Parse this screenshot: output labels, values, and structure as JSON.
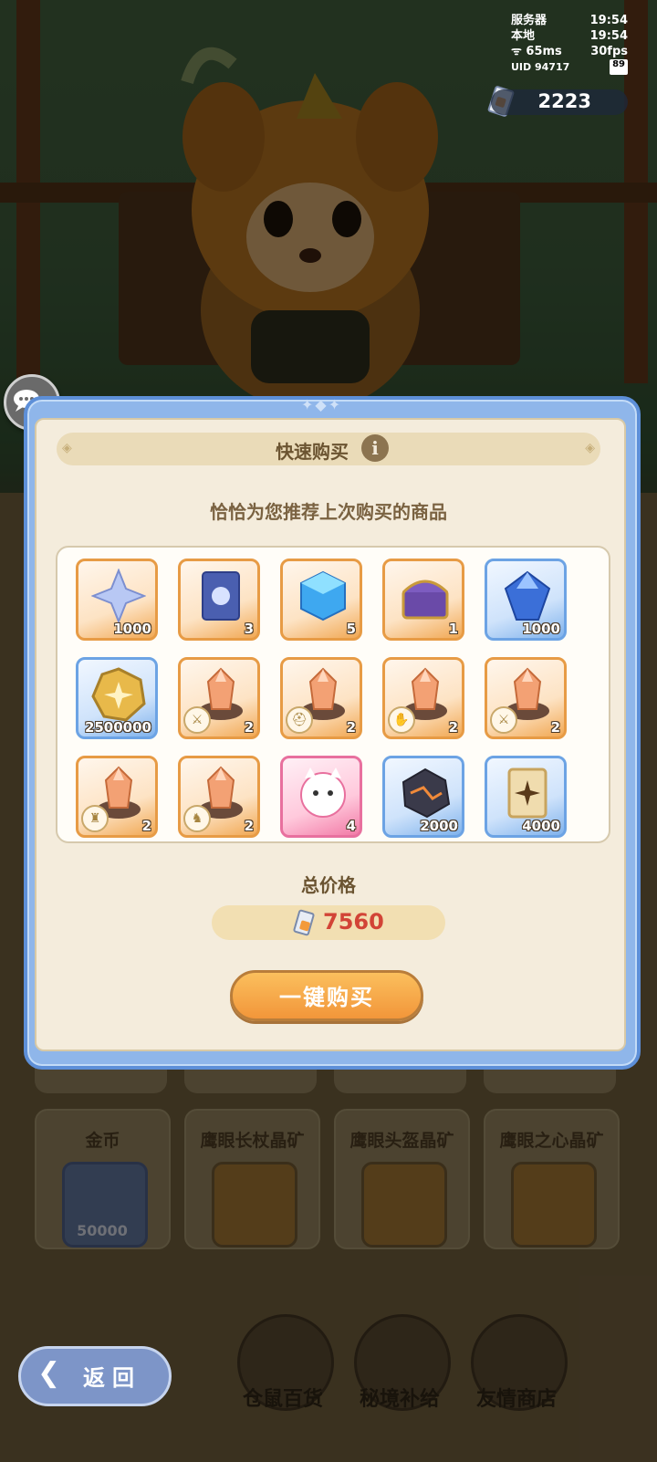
{
  "status": {
    "server_label": "服务器",
    "server_time": "19:54",
    "local_label": "本地",
    "local_time": "19:54",
    "ping": "65ms",
    "fps": "30fps",
    "uid": "UID  94717",
    "battery": "89"
  },
  "currency": {
    "icon": "ticket-icon",
    "amount": "2223"
  },
  "modal": {
    "title": "快速购买",
    "info_icon": "info-icon",
    "subtitle": "恰恰为您推荐上次购买的商品",
    "items": [
      {
        "name": "star-crystal-item",
        "icon": "star-crystal-icon",
        "qty": "1000",
        "frame": "orange"
      },
      {
        "name": "blue-card-item",
        "icon": "blue-card-icon",
        "qty": "3",
        "frame": "orange"
      },
      {
        "name": "rainbow-cube-item",
        "icon": "rainbow-cube-icon",
        "qty": "5",
        "frame": "orange"
      },
      {
        "name": "treasure-chest-item",
        "icon": "treasure-chest-icon",
        "qty": "1",
        "frame": "orange"
      },
      {
        "name": "blue-gem-item",
        "icon": "blue-gem-icon",
        "qty": "1000",
        "frame": "blue"
      },
      {
        "name": "gold-coin-item",
        "icon": "gold-coin-icon",
        "qty": "2500000",
        "frame": "blue"
      },
      {
        "name": "crystal-ore-item",
        "icon": "crystal-ore-icon",
        "qty": "2",
        "frame": "orange",
        "badge": "sword-badge-icon"
      },
      {
        "name": "crystal-ore-item",
        "icon": "crystal-ore-icon",
        "qty": "2",
        "frame": "orange",
        "badge": "helmet-badge-icon"
      },
      {
        "name": "crystal-ore-item",
        "icon": "crystal-ore-icon",
        "qty": "2",
        "frame": "orange",
        "badge": "gloves-badge-icon"
      },
      {
        "name": "crystal-ore-item",
        "icon": "crystal-ore-icon",
        "qty": "2",
        "frame": "orange",
        "badge": "sword-badge-icon"
      },
      {
        "name": "crystal-ore-item",
        "icon": "crystal-ore-icon",
        "qty": "2",
        "frame": "orange",
        "badge": "armor-badge-icon"
      },
      {
        "name": "crystal-ore-item",
        "icon": "crystal-ore-icon",
        "qty": "2",
        "frame": "orange",
        "badge": "boots-badge-icon"
      },
      {
        "name": "pink-cat-item",
        "icon": "pink-cat-icon",
        "qty": "4",
        "frame": "pink"
      },
      {
        "name": "dark-ore-item",
        "icon": "dark-ore-icon",
        "qty": "2000",
        "frame": "blue"
      },
      {
        "name": "star-card-item",
        "icon": "star-card-icon",
        "qty": "4000",
        "frame": "blue"
      }
    ],
    "total_label": "总价格",
    "total_price": "7560",
    "buy_label": "一键购买"
  },
  "shop": {
    "cards": [
      {
        "title": "金币",
        "qty": "50000"
      },
      {
        "title": "鹰眼长杖晶矿"
      },
      {
        "title": "鹰眼头盔晶矿"
      },
      {
        "title": "鹰眼之心晶矿"
      }
    ],
    "nav": [
      {
        "label": "仓鼠百货"
      },
      {
        "label": "秘境补给"
      },
      {
        "label": "友情商店"
      }
    ]
  },
  "back_label": "返回",
  "colors": {
    "frame_blue": "#5d8fd8",
    "panel_cream": "#f4ecdc",
    "accent_orange": "#f2963a",
    "price_red": "#d24436"
  }
}
